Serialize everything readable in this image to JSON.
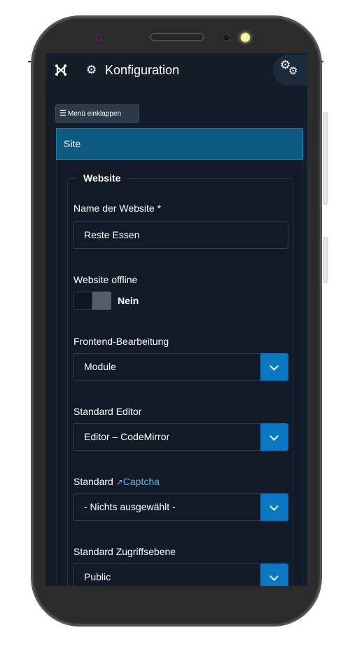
{
  "header": {
    "title": "Konfiguration",
    "logo_icon": "joomla-icon",
    "title_icon": "gear-icon",
    "options_icon": "gears-icon"
  },
  "sidebar_toggle": {
    "label": "Menü einklappen",
    "icon": "bars-icon"
  },
  "tab": {
    "label": "Site",
    "color": "#0c5a82"
  },
  "fieldset": {
    "legend": "Website"
  },
  "fields": {
    "site_name": {
      "label": "Name der Website *",
      "value": "Reste Essen"
    },
    "offline": {
      "label": "Website offline",
      "state": "Nein"
    },
    "frontend_edit": {
      "label": "Frontend-Bearbeitung",
      "value": "Module"
    },
    "editor": {
      "label": "Standard Editor",
      "value": "Editor – CodeMirror"
    },
    "captcha": {
      "label_prefix": "Standard",
      "link_text": "Captcha",
      "value": "- Nichts ausgewählt -"
    },
    "access": {
      "label": "Standard Zugriffsebene",
      "value": "Public"
    }
  },
  "colors": {
    "accent": "#0a78c0",
    "background": "#131d29",
    "link": "#5ab4ea"
  }
}
